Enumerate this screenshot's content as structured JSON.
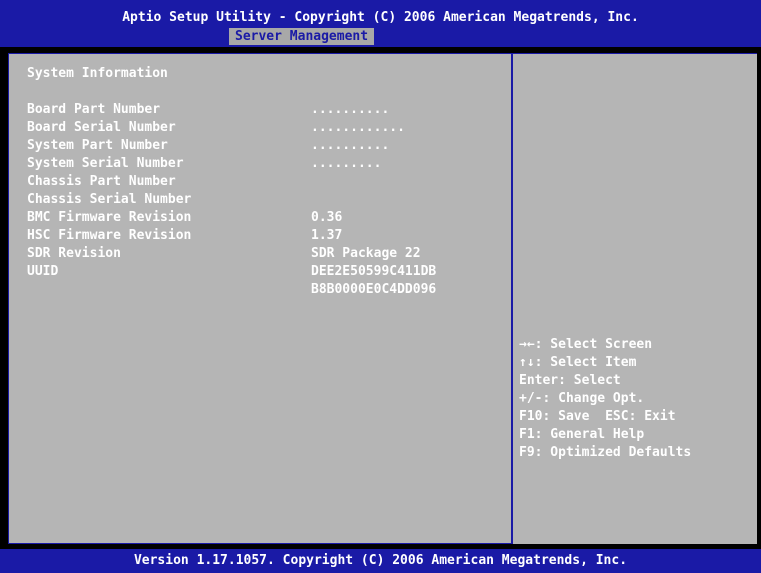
{
  "header": {
    "title": "Aptio Setup Utility - Copyright (C) 2006 American Megatrends, Inc.",
    "active_tab": "Server Management"
  },
  "main": {
    "section_title": "System Information",
    "rows": [
      {
        "label": "Board Part Number",
        "value": ".........."
      },
      {
        "label": "Board Serial Number",
        "value": "............"
      },
      {
        "label": "System Part Number",
        "value": ".........."
      },
      {
        "label": "System Serial Number",
        "value": "........."
      },
      {
        "label": "Chassis Part Number",
        "value": ""
      },
      {
        "label": "Chassis Serial Number",
        "value": ""
      },
      {
        "label": "BMC Firmware Revision",
        "value": "0.36"
      },
      {
        "label": "HSC Firmware Revision",
        "value": "1.37"
      },
      {
        "label": "SDR Revision",
        "value": "SDR Package 22"
      },
      {
        "label": "UUID",
        "value": "DEE2E50599C411DB"
      },
      {
        "label": "",
        "value": "B8B0000E0C4DD096"
      }
    ]
  },
  "help": {
    "lines": [
      "→←: Select Screen",
      "↑↓: Select Item",
      "Enter: Select",
      "+/-: Change Opt.",
      "F10: Save  ESC: Exit",
      "F1: General Help",
      "F9: Optimized Defaults"
    ]
  },
  "footer": {
    "text": "Version 1.17.1057. Copyright (C) 2006 American Megatrends, Inc."
  },
  "colors": {
    "bar_blue": "#1a1aa6",
    "panel_gray": "#b5b5b5",
    "text_white": "#ffffff"
  }
}
